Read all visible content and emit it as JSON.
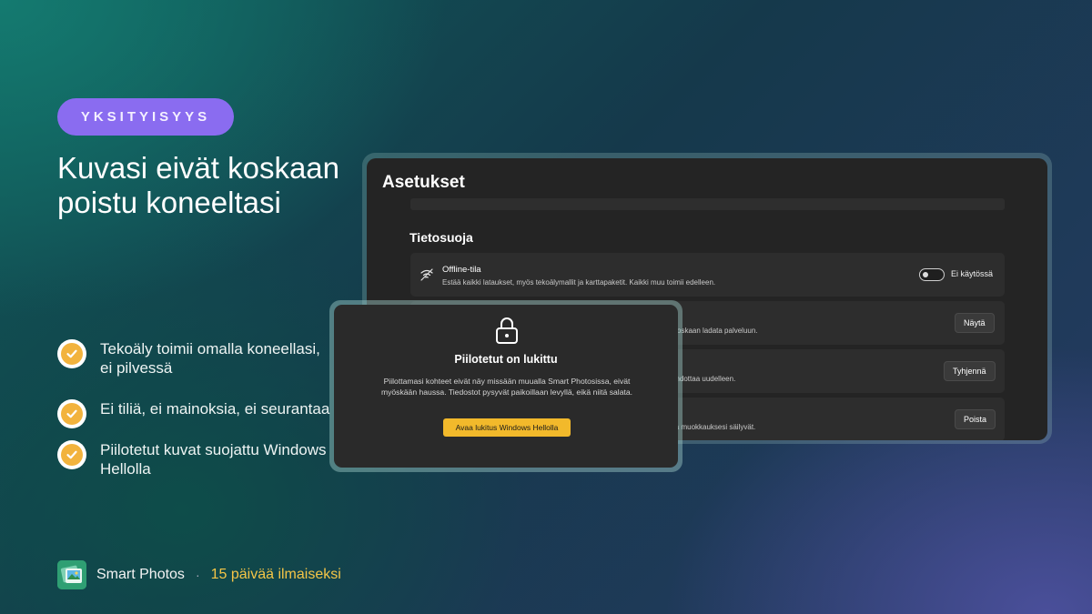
{
  "promo": {
    "badge": "YKSITYISYYS",
    "headline": "Kuvasi eivät koskaan poistu koneeltasi",
    "features": [
      "Tekoäly toimii omalla koneellasi, ei pilvessä",
      "Ei tiliä, ei mainoksia, ei seurantaa",
      "Piilotetut kuvat suojattu Windows Hellolla"
    ]
  },
  "footer": {
    "app_name": "Smart Photos",
    "separator": "·",
    "trial": "15 päivää ilmaiseksi"
  },
  "settings": {
    "title": "Asetukset",
    "section": "Tietosuoja",
    "offline": {
      "title": "Offline-tila",
      "description": "Estää kaikki lataukset, myös tekoälymallit ja karttapaketit. Kaikki muu toimii edelleen.",
      "toggle_state": "Ei käytössä",
      "enabled": false
    },
    "rows": [
      {
        "partial_description": "koskaan ladata palveluun.",
        "button": "Näytä"
      },
      {
        "partial_description": "ehdottaa uudelleen.",
        "button": "Tyhjennä"
      },
      {
        "partial_description": "ja muokkauksesi säilyvät.",
        "button": "Poista"
      }
    ]
  },
  "lock_dialog": {
    "icon": "lock-icon",
    "title": "Piilotetut on lukittu",
    "body": "Piilottamasi kohteet eivät näy missään muualla Smart Photosissa, eivät myöskään haussa. Tiedostot pysyvät paikoillaan levyllä, eikä niitä salata.",
    "unlock_button": "Avaa lukitus Windows Hellolla"
  },
  "colors": {
    "badge": "#8a6cf0",
    "check": "#f2b33d",
    "accent_button": "#f2b92b",
    "trial_text": "#f4c547"
  }
}
